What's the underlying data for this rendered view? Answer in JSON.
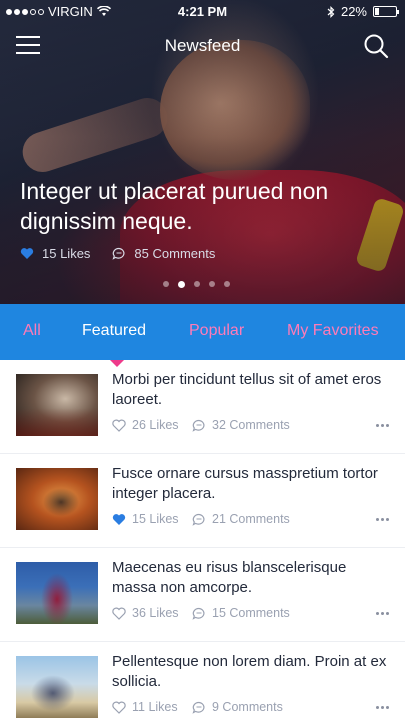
{
  "status": {
    "carrier": "VIRGIN",
    "time": "4:21 PM",
    "battery": "22%",
    "battery_level": 0.22,
    "signal_bars": 3
  },
  "nav": {
    "title": "Newsfeed"
  },
  "hero": {
    "headline": "Integer ut placerat purued non dignissim neque.",
    "likes": "15 Likes",
    "comments": "85 Comments",
    "pager_count": 5,
    "pager_active": 1
  },
  "tabs": [
    {
      "label": "All",
      "active": false
    },
    {
      "label": "Featured",
      "active": true
    },
    {
      "label": "Popular",
      "active": false
    },
    {
      "label": "My Favorites",
      "active": false
    }
  ],
  "items": [
    {
      "title": "Morbi per tincidunt tellus sit of amet eros laoreet.",
      "likes": "26 Likes",
      "comments": "32 Comments",
      "liked": false
    },
    {
      "title": "Fusce ornare cursus masspretium tortor integer placera.",
      "likes": "15 Likes",
      "comments": "21 Comments",
      "liked": true
    },
    {
      "title": "Maecenas eu risus blanscelerisque massa non amcorpe.",
      "likes": "36 Likes",
      "comments": "15 Comments",
      "liked": false
    },
    {
      "title": "Pellentesque non lorem diam. Proin at ex sollicia.",
      "likes": "11 Likes",
      "comments": "9 Comments",
      "liked": false
    }
  ],
  "colors": {
    "tab_bar": "#1f86e0",
    "tab_inactive": "#ff7bb8",
    "indicator": "#ee3a8a",
    "like_active": "#2a7de1"
  }
}
